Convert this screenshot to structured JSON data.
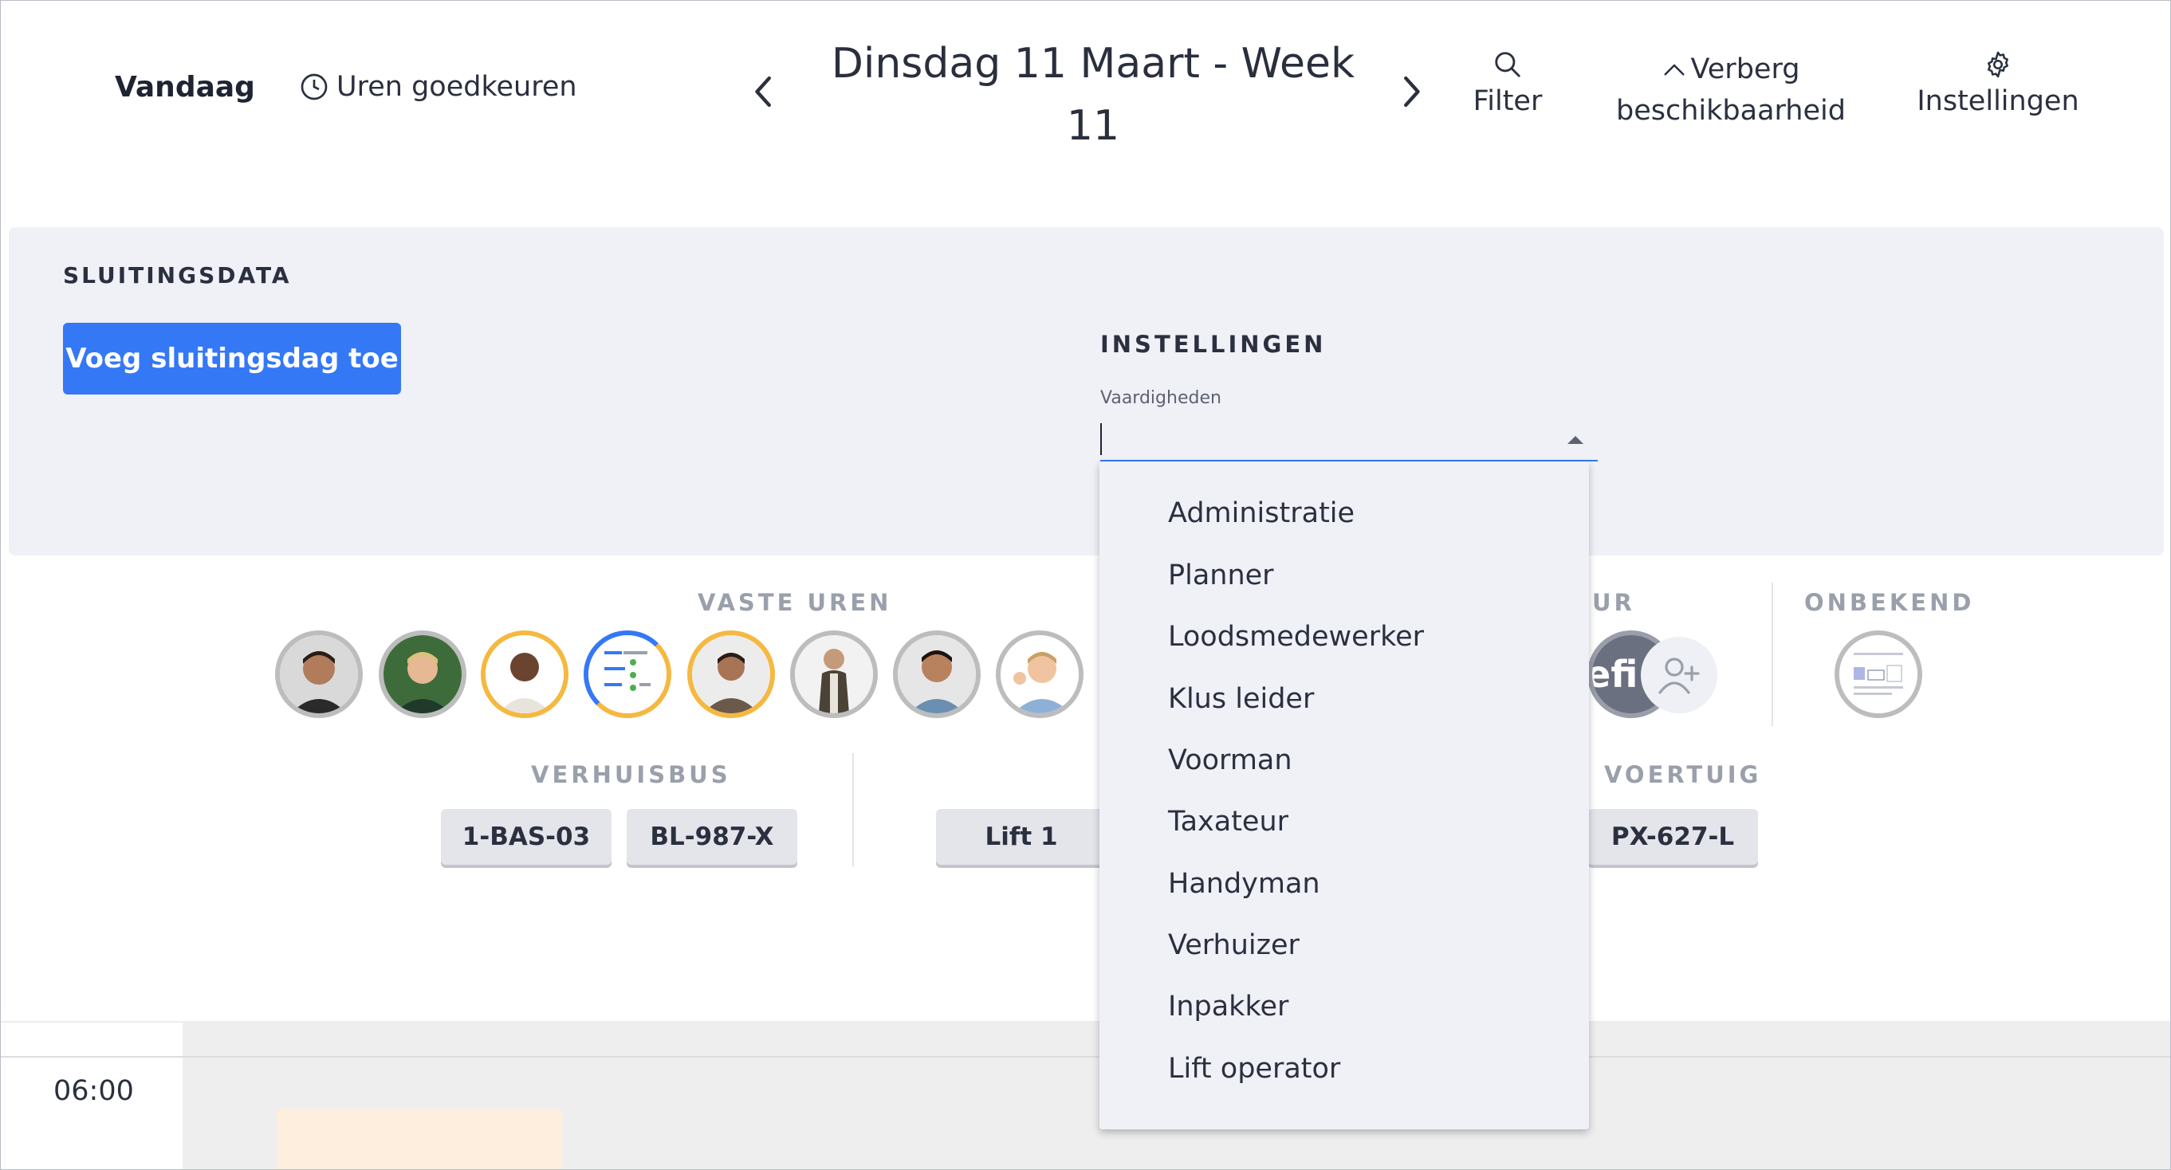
{
  "header": {
    "today_label": "Vandaag",
    "approve_label": "Uren goedkeuren",
    "title": "Dinsdag 11 Maart - Week 11",
    "filter_label": "Filter",
    "hide_availability_line1": "Verberg",
    "hide_availability_line2": "beschikbaarheid",
    "settings_label": "Instellingen"
  },
  "closing": {
    "title": "SLUITINGSDATA",
    "add_button": "Voeg sluitingsdag toe"
  },
  "settings_panel": {
    "title": "INSTELLINGEN",
    "skills_label": "Vaardigheden",
    "skills_value": ""
  },
  "skills_options": [
    "Administratie",
    "Planner",
    "Loodsmedewerker",
    "Klus leider",
    "Voorman",
    "Taxateur",
    "Handyman",
    "Verhuizer",
    "Inpakker",
    "Lift operator"
  ],
  "resources": {
    "fixed_hours_title": "VASTE UREN",
    "partial_title": "UR",
    "unknown_title": "ONBEKEND",
    "moving_van_title": "VERHUISBUS",
    "vehicle_title": "VOERTUIG",
    "partial_avatar_text": "efi",
    "moving_vans": [
      "1-BAS-03",
      "BL-987-X"
    ],
    "lift": "Lift 1",
    "vehicle": "PX-627-L"
  },
  "timeline": {
    "time": "06:00"
  },
  "colors": {
    "accent": "#3478f6",
    "ring_orange": "#f5b840",
    "ring_gray": "#bdbdbd",
    "panel_bg": "#f0f1f7"
  }
}
